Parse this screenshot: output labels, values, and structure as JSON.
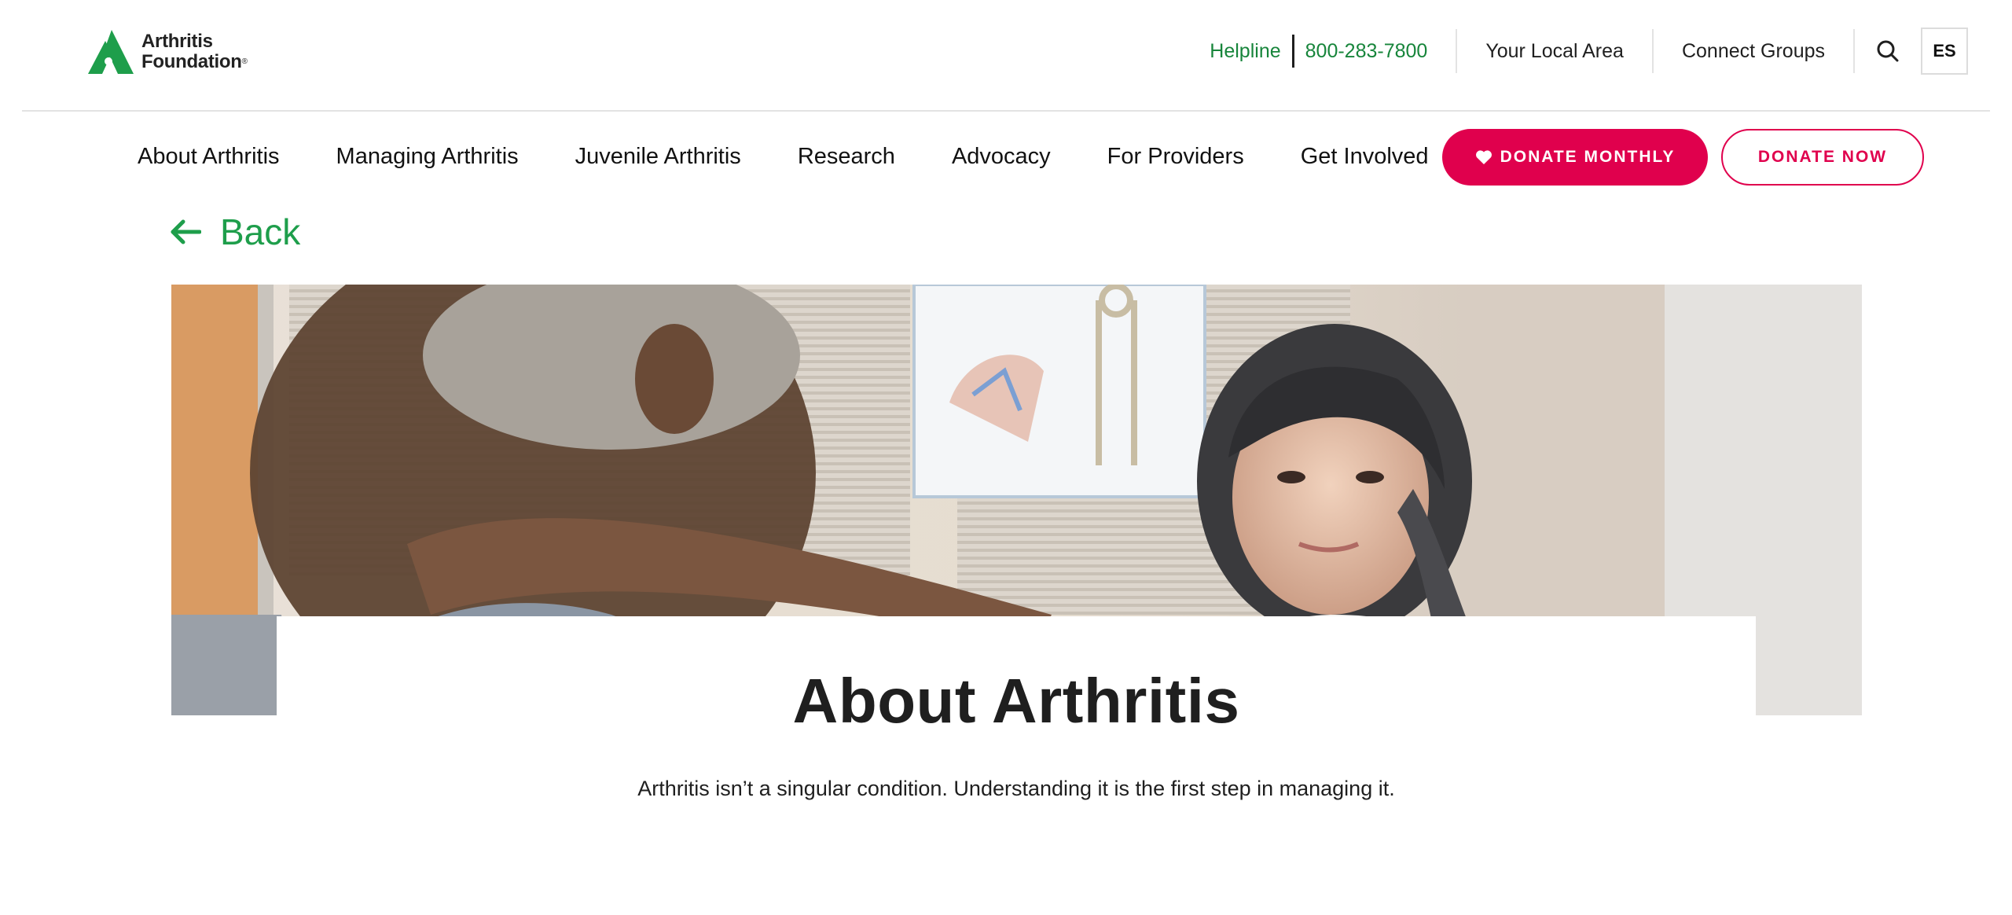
{
  "brand": {
    "name_line1": "Arthritis",
    "name_line2": "Foundation",
    "registered": "®",
    "green": "#1e9e4b",
    "pink": "#e0004d"
  },
  "utility": {
    "helpline_label": "Helpline",
    "helpline_number": "800-283-7800",
    "local_area": "Your Local Area",
    "connect_groups": "Connect Groups",
    "search_icon": "search-icon",
    "language": "ES"
  },
  "nav": {
    "items": [
      "About Arthritis",
      "Managing Arthritis",
      "Juvenile Arthritis",
      "Research",
      "Advocacy",
      "For Providers",
      "Get Involved"
    ],
    "donate_monthly": "DONATE MONTHLY",
    "donate_monthly_icon": "heart-icon",
    "donate_now": "DONATE NOW"
  },
  "back": {
    "label": "Back",
    "icon": "arrow-left-icon"
  },
  "hero": {
    "title": "About Arthritis",
    "subtitle": "Arthritis isn’t a singular condition. Understanding it is the first step in managing it."
  }
}
